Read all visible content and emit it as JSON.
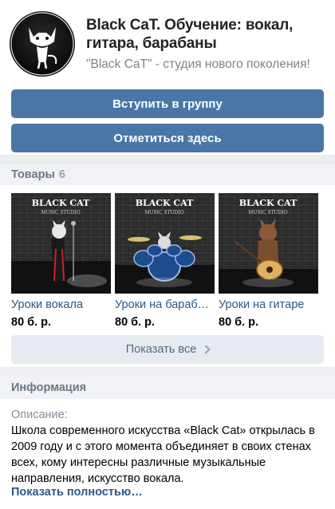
{
  "group": {
    "title": "Black CaT. Обучение: вокал, гитара, барабаны",
    "status": "\"Black CaT\" - студия нового поколения!",
    "join_button": "Вступить в группу",
    "checkin_button": "Отметиться здесь",
    "avatar_icon": "black-cat-logo-icon"
  },
  "goods": {
    "header_label": "Товары",
    "count": "6",
    "brand_line": "BLACK CAT",
    "brand_sub": "MUSIC STUDIO",
    "items": [
      {
        "name": "Уроки вокала",
        "price": "80 б. р."
      },
      {
        "name": "Уроки на барабанах",
        "price": "80 б. р."
      },
      {
        "name": "Уроки на гитаре",
        "price": "80 б. р."
      }
    ],
    "show_all": "Показать все"
  },
  "info": {
    "header_label": "Информация",
    "description_label": "Описание:",
    "description_text": "Школа современного искусства «Black Cat» открылась в 2009 году и с этого момента объединяет в своих стенах всех, кому интересны различные музыкальные направления, искусство вокала.",
    "show_more": "Показать полностью…"
  },
  "colors": {
    "accent": "#4a76a8",
    "link": "#2a5885",
    "section_bg": "#f0f2f5",
    "muted": "#818c99"
  }
}
